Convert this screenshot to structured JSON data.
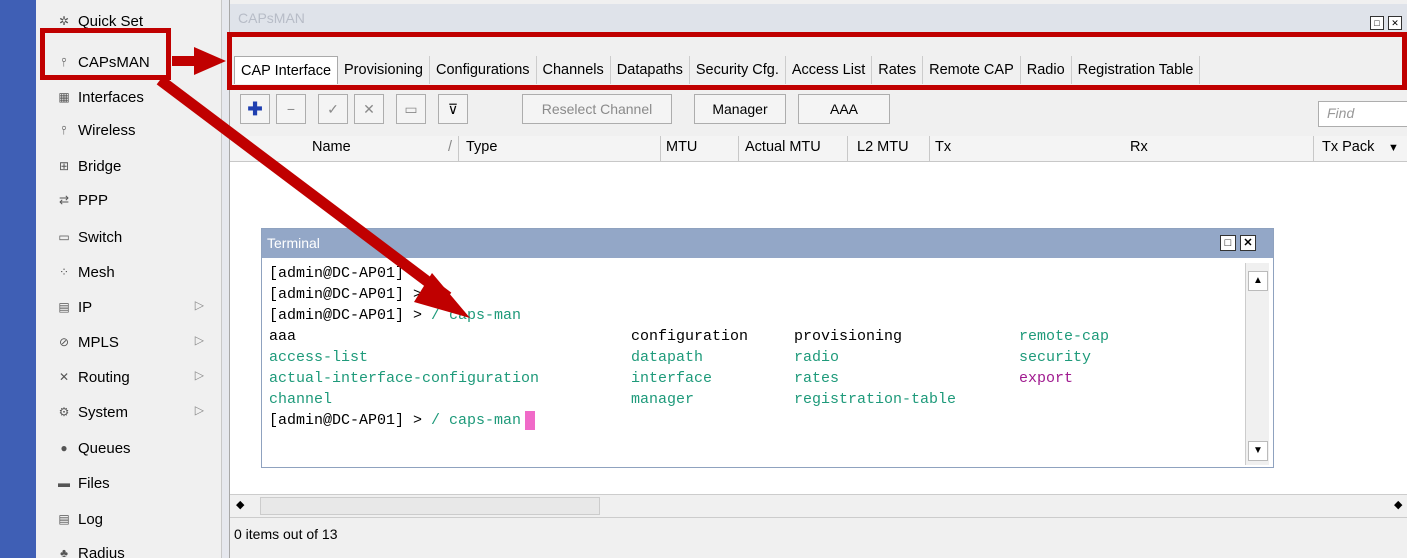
{
  "sidebar": {
    "items": [
      {
        "label": "Quick Set",
        "icon": "wand-icon",
        "submenu": false
      },
      {
        "label": "CAPsMAN",
        "icon": "antenna-icon",
        "submenu": false
      },
      {
        "label": "Interfaces",
        "icon": "interfaces-icon",
        "submenu": false
      },
      {
        "label": "Wireless",
        "icon": "antenna-icon",
        "submenu": false
      },
      {
        "label": "Bridge",
        "icon": "bridge-icon",
        "submenu": false
      },
      {
        "label": "PPP",
        "icon": "ppp-icon",
        "submenu": false
      },
      {
        "label": "Switch",
        "icon": "switch-icon",
        "submenu": false
      },
      {
        "label": "Mesh",
        "icon": "mesh-icon",
        "submenu": false
      },
      {
        "label": "IP",
        "icon": "ip-icon",
        "submenu": true
      },
      {
        "label": "MPLS",
        "icon": "mpls-icon",
        "submenu": true
      },
      {
        "label": "Routing",
        "icon": "routing-icon",
        "submenu": true
      },
      {
        "label": "System",
        "icon": "gear-icon",
        "submenu": true
      },
      {
        "label": "Queues",
        "icon": "queues-icon",
        "submenu": false
      },
      {
        "label": "Files",
        "icon": "folder-icon",
        "submenu": false
      },
      {
        "label": "Log",
        "icon": "log-icon",
        "submenu": false
      },
      {
        "label": "Radius",
        "icon": "radius-icon",
        "submenu": false
      }
    ],
    "submenu_glyph": "▷"
  },
  "window": {
    "title": "CAPsMAN",
    "tabs": [
      "CAP Interface",
      "Provisioning",
      "Configurations",
      "Channels",
      "Datapaths",
      "Security Cfg.",
      "Access List",
      "Rates",
      "Remote CAP",
      "Radio",
      "Registration Table"
    ],
    "active_tab": 0,
    "toolbar": {
      "add": "✚",
      "remove": "−",
      "enable": "✓",
      "disable": "✕",
      "comment": "▭",
      "filter": "⊽",
      "reselect": "Reselect Channel",
      "manager": "Manager",
      "aaa": "AAA"
    },
    "find_placeholder": "Find",
    "columns": [
      "Name",
      "Type",
      "MTU",
      "Actual MTU",
      "L2 MTU",
      "Tx",
      "Rx",
      "Tx Pack"
    ],
    "sort_glyph": "/",
    "status": "0 items out of 13"
  },
  "terminal": {
    "title": "Terminal",
    "prompt_user": "admin@DC-AP01",
    "lines": [
      {
        "text": "[admin@DC-AP01] >"
      },
      {
        "text": "[admin@DC-AP01] >"
      },
      {
        "text": "[admin@DC-AP01] > ",
        "cmd": "/ caps-man"
      }
    ],
    "completions": [
      [
        "aaa",
        "configuration",
        "provisioning",
        "remote-cap"
      ],
      [
        "access-list",
        "datapath",
        "radio",
        "security"
      ],
      [
        "actual-interface-configuration",
        "interface",
        "rates",
        "export"
      ],
      [
        "channel",
        "manager",
        "registration-table",
        ""
      ]
    ],
    "last_prompt": "[admin@DC-AP01] > ",
    "last_cmd": "/ caps-man"
  },
  "colors": {
    "annotation": "#c00000",
    "terminal_title": "#93a7c7",
    "terminal_user": "#168a8a",
    "terminal_cmd": "#1e9a7a",
    "terminal_export": "#a01a8f",
    "cursor": "#f06ac8"
  }
}
